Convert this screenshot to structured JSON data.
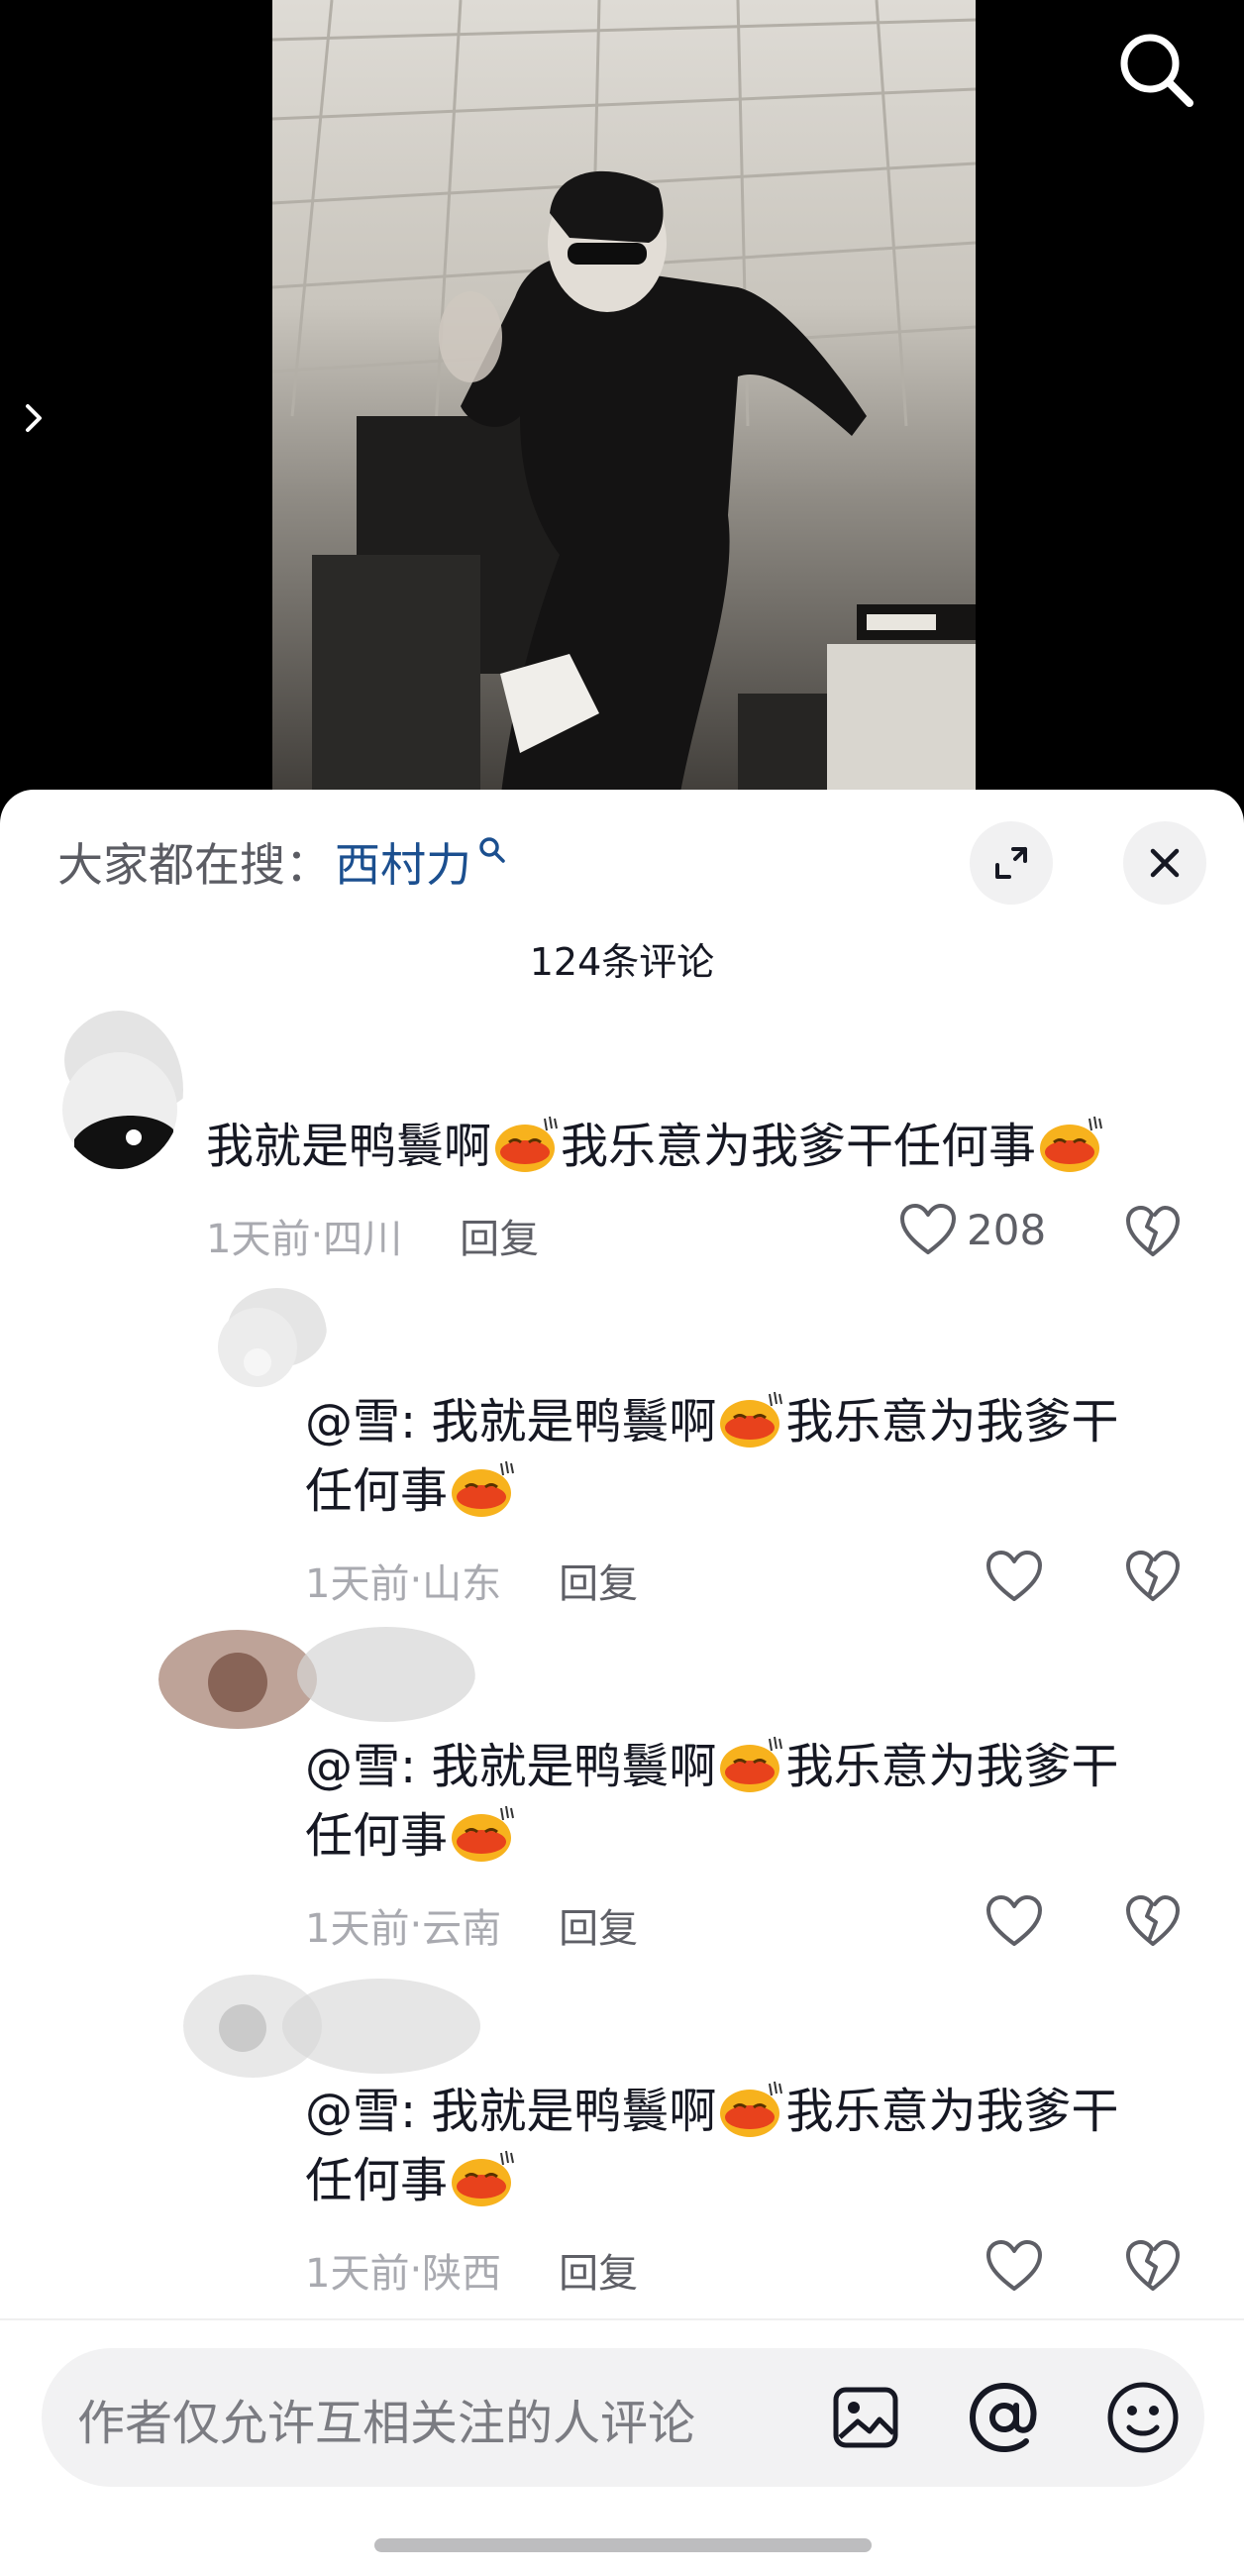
{
  "video": {
    "search_icon": "search-icon",
    "side_arrow_icon": "chevron-right-icon"
  },
  "hot_search": {
    "prefix": "大家都在搜：",
    "term": "西村力",
    "term_icon": "search-icon",
    "term_color": "#1b4f8f"
  },
  "header_buttons": {
    "expand_icon": "expand-icon",
    "close_icon": "close-icon"
  },
  "comment_count": "124条评论",
  "comments": [
    {
      "text_before": "我就是鸭鬟啊",
      "text_middle": "我乐意为我爹干任何事",
      "time": "1天前",
      "location": "四川",
      "reply": "回复",
      "likes": "208"
    },
    {
      "text_before": "@雪: 我就是鸭鬟啊",
      "text_middle": "我乐意为我爹干",
      "text_line2": "任何事",
      "time": "1天前",
      "location": "山东",
      "reply": "回复"
    },
    {
      "text_before": "@雪: 我就是鸭鬟啊",
      "text_middle": "我乐意为我爹干",
      "text_line2": "任何事",
      "time": "1天前",
      "location": "云南",
      "reply": "回复"
    },
    {
      "text_before": "@雪: 我就是鸭鬟啊",
      "text_middle": "我乐意为我爹干",
      "text_line2": "任何事",
      "time": "1天前",
      "location": "陕西",
      "reply": "回复"
    }
  ],
  "meta_separator": " · ",
  "bottom_bar": {
    "placeholder": "作者仅允许互相关注的人评论",
    "image_icon": "image-icon",
    "mention_icon": "at-mention-icon",
    "emoji_icon": "emoji-icon"
  },
  "colors": {
    "link_blue": "#1b4f8f",
    "text": "#161823",
    "muted": "#a9aab0"
  }
}
